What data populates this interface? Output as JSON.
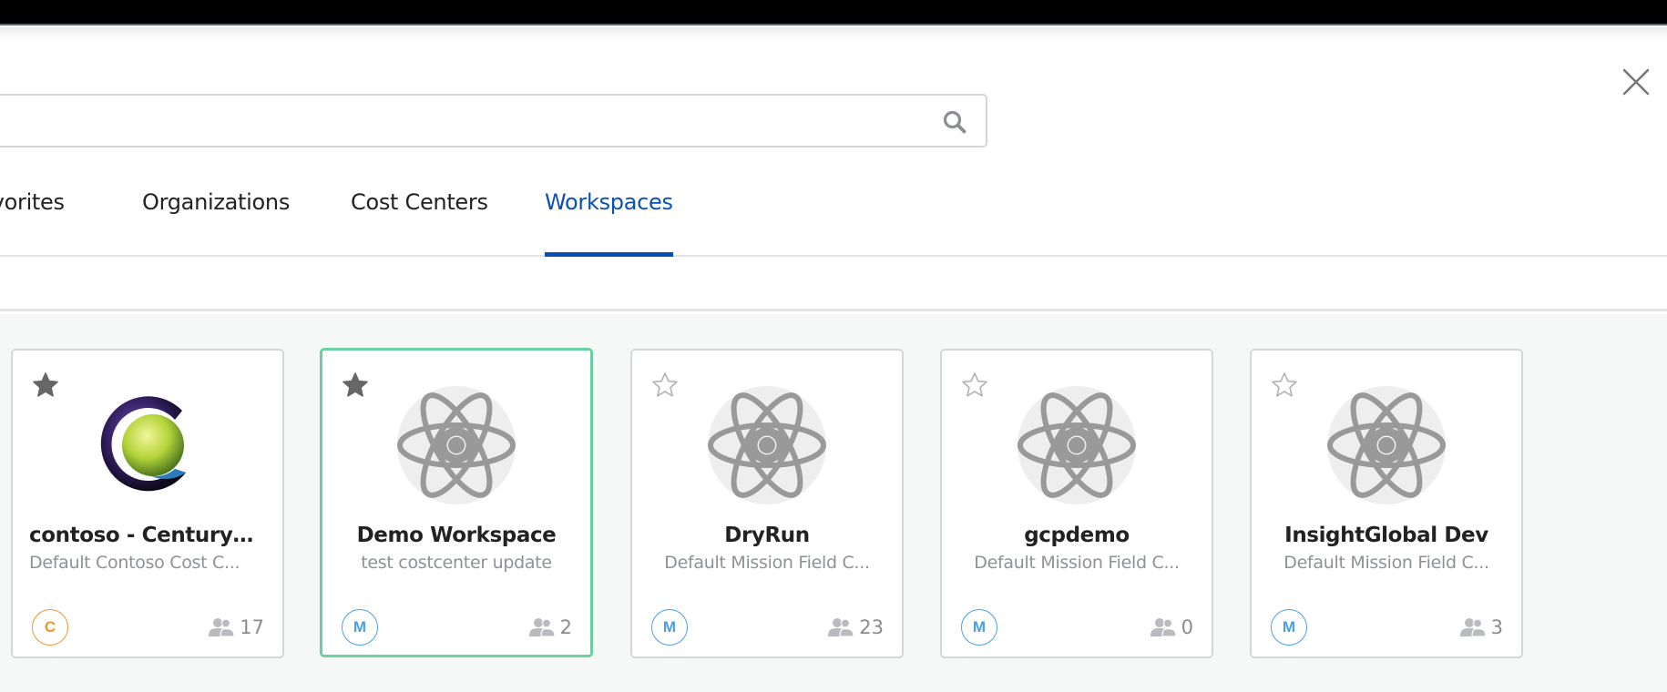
{
  "search": {
    "value": "",
    "placeholder": ""
  },
  "tabs": [
    {
      "label": "Favorites",
      "active": false
    },
    {
      "label": "Organizations",
      "active": false
    },
    {
      "label": "Cost Centers",
      "active": false
    },
    {
      "label": "Workspaces",
      "active": true
    }
  ],
  "colors": {
    "accent": "#0a4fb5",
    "selected_border": "#6bd0a0",
    "badge_orange": "#f0942e",
    "badge_blue": "#4a9ee8",
    "icon_grey": "#999999"
  },
  "workspaces": [
    {
      "name": "contoso - CenturyL...",
      "cost_center": "Default Contoso Cost C...",
      "favorite": true,
      "logo": "contoso-logo",
      "org_badge": "C",
      "members": "17",
      "selected": false
    },
    {
      "name": "Demo Workspace",
      "cost_center": "test costcenter update",
      "favorite": true,
      "logo": "atom-icon",
      "org_badge": "M",
      "members": "2",
      "selected": true
    },
    {
      "name": "DryRun",
      "cost_center": "Default Mission Field C...",
      "favorite": false,
      "logo": "atom-icon",
      "org_badge": "M",
      "members": "23",
      "selected": false
    },
    {
      "name": "gcpdemo",
      "cost_center": "Default Mission Field C...",
      "favorite": false,
      "logo": "atom-icon",
      "org_badge": "M",
      "members": "0",
      "selected": false
    },
    {
      "name": "InsightGlobal Dev",
      "cost_center": "Default Mission Field C...",
      "favorite": false,
      "logo": "atom-icon",
      "org_badge": "M",
      "members": "3",
      "selected": false
    }
  ]
}
